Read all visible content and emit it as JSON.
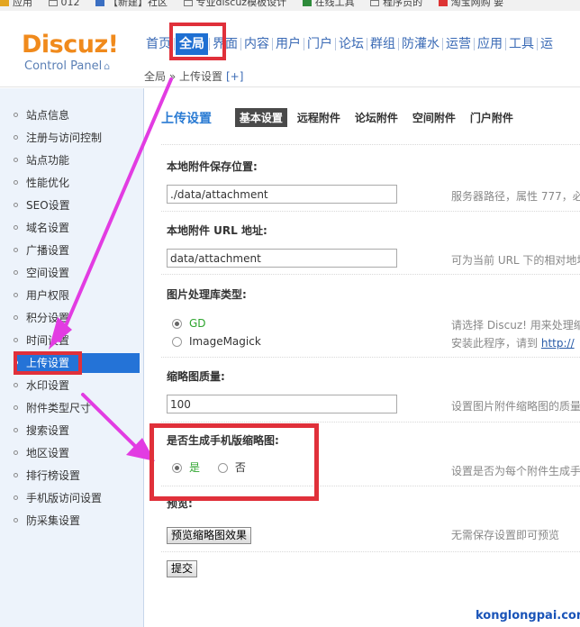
{
  "bookmarks": [
    "应用",
    "012",
    "【新建】社区",
    "专业discuz模板设计",
    "在线工具",
    "程序员的",
    "淘宝网购 要"
  ],
  "logo": {
    "brand": "Discuz!",
    "subtitle": "Control Panel"
  },
  "nav": {
    "items": [
      "首页",
      "全局",
      "界面",
      "内容",
      "用户",
      "门户",
      "论坛",
      "群组",
      "防灌水",
      "运营",
      "应用",
      "工具",
      "运"
    ],
    "active_index": 1
  },
  "breadcrumb": {
    "text": "全局 » 上传设置",
    "add": "[+]"
  },
  "sidebar": {
    "items": [
      "站点信息",
      "注册与访问控制",
      "站点功能",
      "性能优化",
      "SEO设置",
      "域名设置",
      "广播设置",
      "空间设置",
      "用户权限",
      "积分设置",
      "时间设置",
      "上传设置",
      "水印设置",
      "附件类型尺寸",
      "搜索设置",
      "地区设置",
      "排行榜设置",
      "手机版访问设置",
      "防采集设置"
    ],
    "active_index": 11
  },
  "main": {
    "title": "上传设置",
    "tabs": [
      "基本设置",
      "远程附件",
      "论坛附件",
      "空间附件",
      "门户附件"
    ],
    "active_tab": 0,
    "fields": {
      "attach_dir": {
        "label": "本地附件保存位置:",
        "value": "./data/attachment",
        "hint": "服务器路径，属性 777，必"
      },
      "attach_url": {
        "label": "本地附件 URL 地址:",
        "value": "data/attachment",
        "hint": "可为当前 URL 下的相对地址"
      },
      "image_lib": {
        "label": "图片处理库类型:",
        "options": [
          "GD",
          "ImageMagick"
        ],
        "selected": 0,
        "hint_line1": "请选择 Discuz! 用来处理缩",
        "hint_line2_prefix": "安装此程序，请到",
        "hint_link": "http://"
      },
      "thumb_quality": {
        "label": "缩略图质量:",
        "value": "100",
        "hint": "设置图片附件缩略图的质量"
      },
      "mobile_thumb": {
        "label": "是否生成手机版缩略图:",
        "options": [
          "是",
          "否"
        ],
        "selected": 0,
        "hint": "设置是否为每个附件生成手"
      },
      "preview": {
        "label": "预览:",
        "button": "预览缩略图效果",
        "hint": "无需保存设置即可预览"
      }
    },
    "submit": "提交"
  },
  "watermark": "konglongpai.com",
  "colors": {
    "accent": "#2473d7",
    "highlight": "#e0303a",
    "arrow": "#e23ce2",
    "logo": "#f08a1c"
  }
}
